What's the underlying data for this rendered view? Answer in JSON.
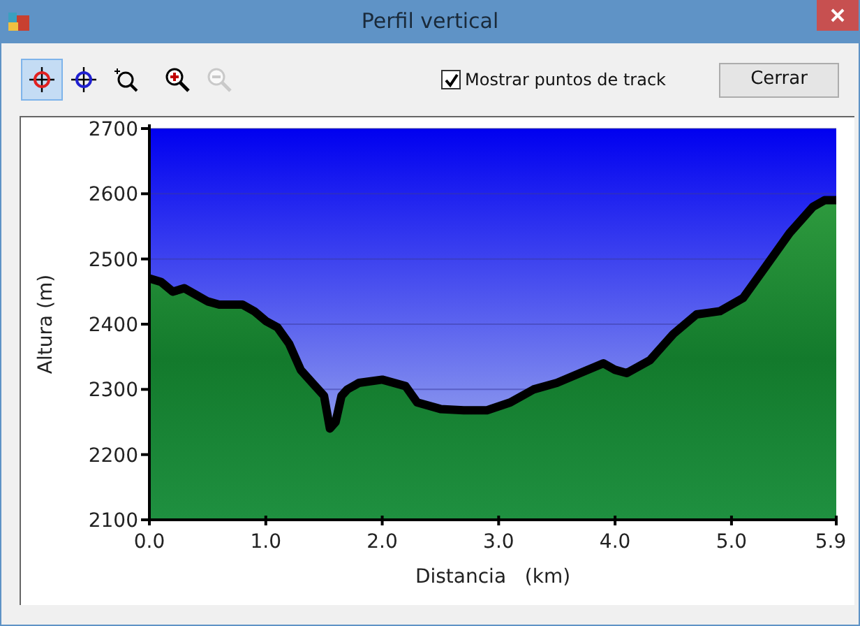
{
  "window": {
    "title": "Perfil vertical"
  },
  "toolbar": {
    "tools": [
      {
        "kind": "pick-red",
        "selected": true,
        "disabled": false
      },
      {
        "kind": "pick-blue",
        "selected": false,
        "disabled": false
      },
      {
        "kind": "zoom-region",
        "selected": false,
        "disabled": false
      },
      {
        "kind": "zoom-in",
        "selected": false,
        "disabled": false
      },
      {
        "kind": "zoom-out",
        "selected": false,
        "disabled": true
      }
    ],
    "show_points": {
      "label": "Mostrar puntos de track",
      "checked": true
    },
    "close_button": "Cerrar"
  },
  "chart_data": {
    "type": "area",
    "xlabel": "Distancia   (km)",
    "ylabel": "Altura (m)",
    "x": [
      0,
      0.1,
      0.2,
      0.3,
      0.4,
      0.5,
      0.6,
      0.8,
      0.9,
      1.0,
      1.1,
      1.2,
      1.3,
      1.4,
      1.5,
      1.55,
      1.6,
      1.65,
      1.7,
      1.8,
      2.0,
      2.2,
      2.3,
      2.5,
      2.7,
      2.9,
      3.1,
      3.3,
      3.5,
      3.7,
      3.9,
      4.0,
      4.1,
      4.3,
      4.5,
      4.7,
      4.9,
      5.1,
      5.3,
      5.5,
      5.7,
      5.8,
      5.9
    ],
    "grid": true,
    "series": [
      {
        "color": "#000000",
        "values": [
          2470,
          2465,
          2450,
          2455,
          2445,
          2435,
          2430,
          2430,
          2420,
          2405,
          2395,
          2370,
          2330,
          2310,
          2290,
          2240,
          2250,
          2290,
          2300,
          2310,
          2315,
          2305,
          2280,
          2270,
          2268,
          2268,
          2280,
          2300,
          2310,
          2325,
          2340,
          2330,
          2325,
          2345,
          2385,
          2415,
          2420,
          2440,
          2490,
          2540,
          2580,
          2590,
          2590
        ]
      }
    ],
    "xlim": [
      0,
      5.9
    ],
    "ylim": [
      2100,
      2700
    ],
    "xticks": [
      {
        "value": 0,
        "label": "0.0"
      },
      {
        "value": 1,
        "label": "1.0"
      },
      {
        "value": 2,
        "label": "2.0"
      },
      {
        "value": 3,
        "label": "3.0"
      },
      {
        "value": 4,
        "label": "4.0"
      },
      {
        "value": 5,
        "label": "5.0"
      },
      {
        "value": 5.9,
        "label": "5.9"
      }
    ],
    "yticks": [
      2100,
      2200,
      2300,
      2400,
      2500,
      2600,
      2700
    ]
  }
}
